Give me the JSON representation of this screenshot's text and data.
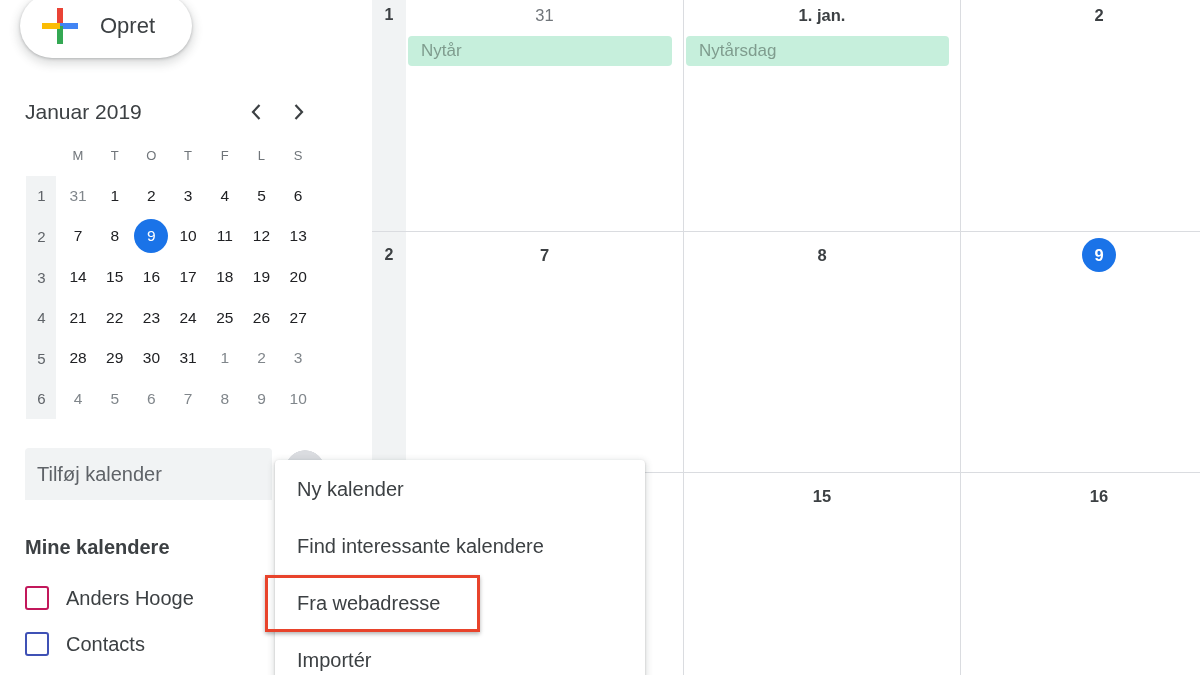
{
  "create_button": {
    "label": "Opret"
  },
  "mini_calendar": {
    "title": "Januar 2019",
    "weekdays": [
      "M",
      "T",
      "O",
      "T",
      "F",
      "L",
      "S"
    ],
    "weeks": [
      {
        "number": "1",
        "days": [
          {
            "date": "31",
            "other_month": true,
            "today": false
          },
          {
            "date": "1",
            "other_month": false,
            "today": false
          },
          {
            "date": "2",
            "other_month": false,
            "today": false
          },
          {
            "date": "3",
            "other_month": false,
            "today": false
          },
          {
            "date": "4",
            "other_month": false,
            "today": false
          },
          {
            "date": "5",
            "other_month": false,
            "today": false
          },
          {
            "date": "6",
            "other_month": false,
            "today": false
          }
        ]
      },
      {
        "number": "2",
        "days": [
          {
            "date": "7",
            "other_month": false,
            "today": false
          },
          {
            "date": "8",
            "other_month": false,
            "today": false
          },
          {
            "date": "9",
            "other_month": false,
            "today": true
          },
          {
            "date": "10",
            "other_month": false,
            "today": false
          },
          {
            "date": "11",
            "other_month": false,
            "today": false
          },
          {
            "date": "12",
            "other_month": false,
            "today": false
          },
          {
            "date": "13",
            "other_month": false,
            "today": false
          }
        ]
      },
      {
        "number": "3",
        "days": [
          {
            "date": "14",
            "other_month": false,
            "today": false
          },
          {
            "date": "15",
            "other_month": false,
            "today": false
          },
          {
            "date": "16",
            "other_month": false,
            "today": false
          },
          {
            "date": "17",
            "other_month": false,
            "today": false
          },
          {
            "date": "18",
            "other_month": false,
            "today": false
          },
          {
            "date": "19",
            "other_month": false,
            "today": false
          },
          {
            "date": "20",
            "other_month": false,
            "today": false
          }
        ]
      },
      {
        "number": "4",
        "days": [
          {
            "date": "21",
            "other_month": false,
            "today": false
          },
          {
            "date": "22",
            "other_month": false,
            "today": false
          },
          {
            "date": "23",
            "other_month": false,
            "today": false
          },
          {
            "date": "24",
            "other_month": false,
            "today": false
          },
          {
            "date": "25",
            "other_month": false,
            "today": false
          },
          {
            "date": "26",
            "other_month": false,
            "today": false
          },
          {
            "date": "27",
            "other_month": false,
            "today": false
          }
        ]
      },
      {
        "number": "5",
        "days": [
          {
            "date": "28",
            "other_month": false,
            "today": false
          },
          {
            "date": "29",
            "other_month": false,
            "today": false
          },
          {
            "date": "30",
            "other_month": false,
            "today": false
          },
          {
            "date": "31",
            "other_month": false,
            "today": false
          },
          {
            "date": "1",
            "other_month": true,
            "today": false
          },
          {
            "date": "2",
            "other_month": true,
            "today": false
          },
          {
            "date": "3",
            "other_month": true,
            "today": false
          }
        ]
      },
      {
        "number": "6",
        "days": [
          {
            "date": "4",
            "other_month": true,
            "today": false
          },
          {
            "date": "5",
            "other_month": true,
            "today": false
          },
          {
            "date": "6",
            "other_month": true,
            "today": false
          },
          {
            "date": "7",
            "other_month": true,
            "today": false
          },
          {
            "date": "8",
            "other_month": true,
            "today": false
          },
          {
            "date": "9",
            "other_month": true,
            "today": false
          },
          {
            "date": "10",
            "other_month": true,
            "today": false
          }
        ]
      }
    ]
  },
  "add_calendar": {
    "placeholder": "Tilføj kalender"
  },
  "my_calendars": {
    "title": "Mine kalendere",
    "items": [
      {
        "name": "Anders Hooge",
        "color": "#c2185b",
        "checked": false
      },
      {
        "name": "Contacts",
        "color": "#3f51b5",
        "checked": false
      }
    ]
  },
  "month_grid": {
    "weeks": [
      {
        "number": "1",
        "days": [
          {
            "date": "31",
            "other_month": true,
            "today": false,
            "events": [
              {
                "title": "Nytår"
              }
            ]
          },
          {
            "date": "1. jan.",
            "other_month": false,
            "today": false,
            "events": [
              {
                "title": "Nytårsdag"
              }
            ]
          },
          {
            "date": "2",
            "other_month": false,
            "today": false
          }
        ]
      },
      {
        "number": "2",
        "days": [
          {
            "date": "7",
            "other_month": false,
            "today": false
          },
          {
            "date": "8",
            "other_month": false,
            "today": false
          },
          {
            "date": "9",
            "other_month": false,
            "today": true
          }
        ]
      },
      {
        "days": [
          {
            "date": "15",
            "other_month": false,
            "today": false
          },
          {
            "date": "16",
            "other_month": false,
            "today": false
          }
        ]
      }
    ]
  },
  "add_menu": {
    "items": [
      {
        "label": "Ny kalender",
        "highlighted": false
      },
      {
        "label": "Find interessante kalendere",
        "highlighted": false
      },
      {
        "label": "Fra webadresse",
        "highlighted": true
      },
      {
        "label": "Importér",
        "highlighted": false
      }
    ]
  }
}
